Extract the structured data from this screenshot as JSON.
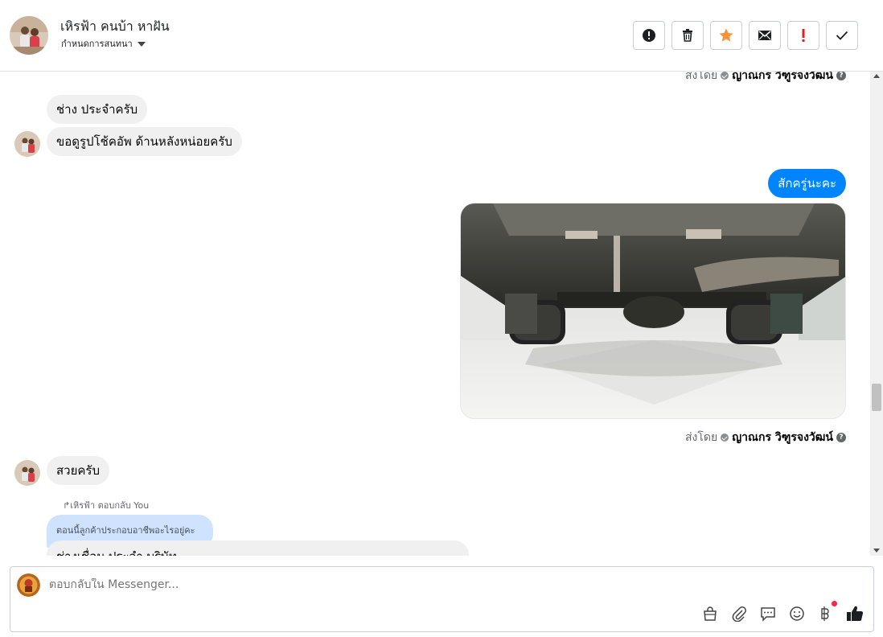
{
  "header": {
    "name": "เหิรฟ้า คนบ้า หาฝัน",
    "subtitle": "กำหนดการสนทนา",
    "actions": [
      "spam",
      "delete",
      "star",
      "mark-unread",
      "important",
      "done"
    ]
  },
  "colors": {
    "accent": "#0084ff",
    "star": "#f7923b",
    "important": "#e02020"
  },
  "conversation": {
    "sent_by_label": "ส่งโดย",
    "sent_by_name": "ญาณกร วิฑูรจงวัฒน์",
    "msg1": "ช่าง ประจำครับ",
    "msg2": "ขอดูรูปโช้คอัพ ด้านหลังหน่อยครับ",
    "out1": "สักครู่นะคะ",
    "photo_alt": "ภาพใต้ท้องรถ",
    "msg3": "สวยครับ",
    "reply_note": "เหิรฟ้า ตอบกลับ You",
    "quoted": "ตอนนี้ลูกค้าประกอบอาชีพอะไรอยู่คะ",
    "msg4": "ช่างเชื่อม ประจำ บริษัท"
  },
  "composer": {
    "placeholder": "ตอบกลับใน Messenger...",
    "icons": [
      "shop-icon",
      "attach-icon",
      "saved-replies-icon",
      "emoji-icon",
      "baht-icon",
      "like-icon"
    ]
  }
}
